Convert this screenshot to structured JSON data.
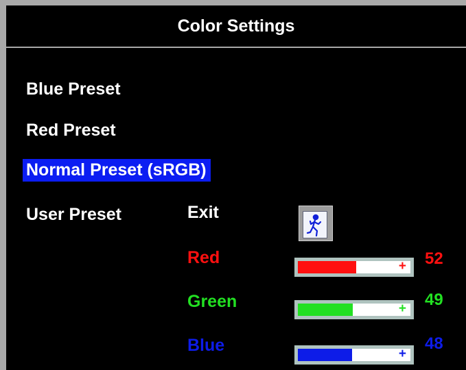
{
  "title": "Color Settings",
  "menu": {
    "blue_preset": "Blue Preset",
    "red_preset": "Red Preset",
    "normal_preset": "Normal Preset (sRGB)",
    "user_preset": "User Preset"
  },
  "user_preset": {
    "exit_label": "Exit",
    "exit_icon": "exit-door-icon",
    "channels": [
      {
        "label": "Red",
        "value": "52",
        "color": "#ff1010",
        "fill_fraction": 0.52
      },
      {
        "label": "Green",
        "value": "49",
        "color": "#22e022",
        "fill_fraction": 0.49
      },
      {
        "label": "Blue",
        "value": "48",
        "color": "#0d1ce8",
        "fill_fraction": 0.48
      }
    ],
    "minus_glyph": "-",
    "plus_glyph": "+"
  },
  "colors": {
    "background": "#000000",
    "frame": "#a9a9a9",
    "selection": "#0b1df2",
    "text": "#ffffff",
    "slider_border": "#afc3bf"
  }
}
